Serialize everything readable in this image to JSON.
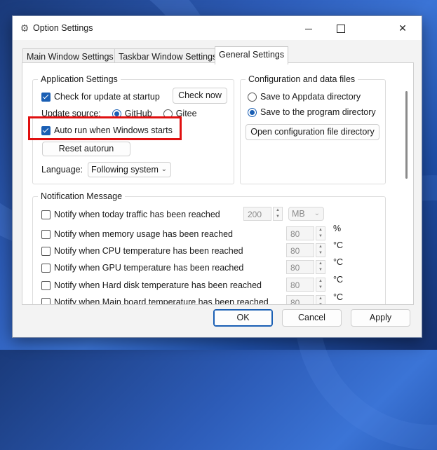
{
  "window": {
    "title": "Option Settings"
  },
  "titlebar_icons": {
    "settings": "gear-icon",
    "minimize": "minimize-icon",
    "maximize": "maximize-icon",
    "close": "close-icon"
  },
  "tabs": [
    {
      "label": "Main Window Settings"
    },
    {
      "label": "Taskbar Window Settings"
    },
    {
      "label": "General Settings"
    }
  ],
  "app_settings": {
    "title": "Application Settings",
    "check_update_label": "Check for update at startup",
    "check_now_label": "Check now",
    "update_source_label": "Update source:",
    "source_github": "GitHub",
    "source_gitee": "Gitee",
    "auto_run_label": "Auto run when Windows starts",
    "reset_autorun_label": "Reset autorun",
    "language_label": "Language:",
    "language_value": "Following system"
  },
  "config_files": {
    "title": "Configuration and data files",
    "appdata_label": "Save to Appdata directory",
    "program_dir_label": "Save to the program directory",
    "open_dir_label": "Open configuration file directory"
  },
  "notifications": {
    "title": "Notification Message",
    "items": [
      {
        "label": "Notify when today traffic has been reached",
        "value": "200",
        "unit": "MB"
      },
      {
        "label": "Notify when memory usage has been reached",
        "value": "80",
        "unit": "%"
      },
      {
        "label": "Notify when CPU temperature has been reached",
        "value": "80",
        "unit": "°C"
      },
      {
        "label": "Notify when GPU temperature has been reached",
        "value": "80",
        "unit": "°C"
      },
      {
        "label": "Notify when Hard disk temperature has been reached",
        "value": "80",
        "unit": "°C"
      },
      {
        "label": "Notify when Main board temperature has been reached",
        "value": "80",
        "unit": "°C"
      }
    ]
  },
  "footer": {
    "ok": "OK",
    "cancel": "Cancel",
    "apply": "Apply"
  },
  "colors": {
    "accent": "#1a5fb4",
    "highlight": "#e01010"
  }
}
